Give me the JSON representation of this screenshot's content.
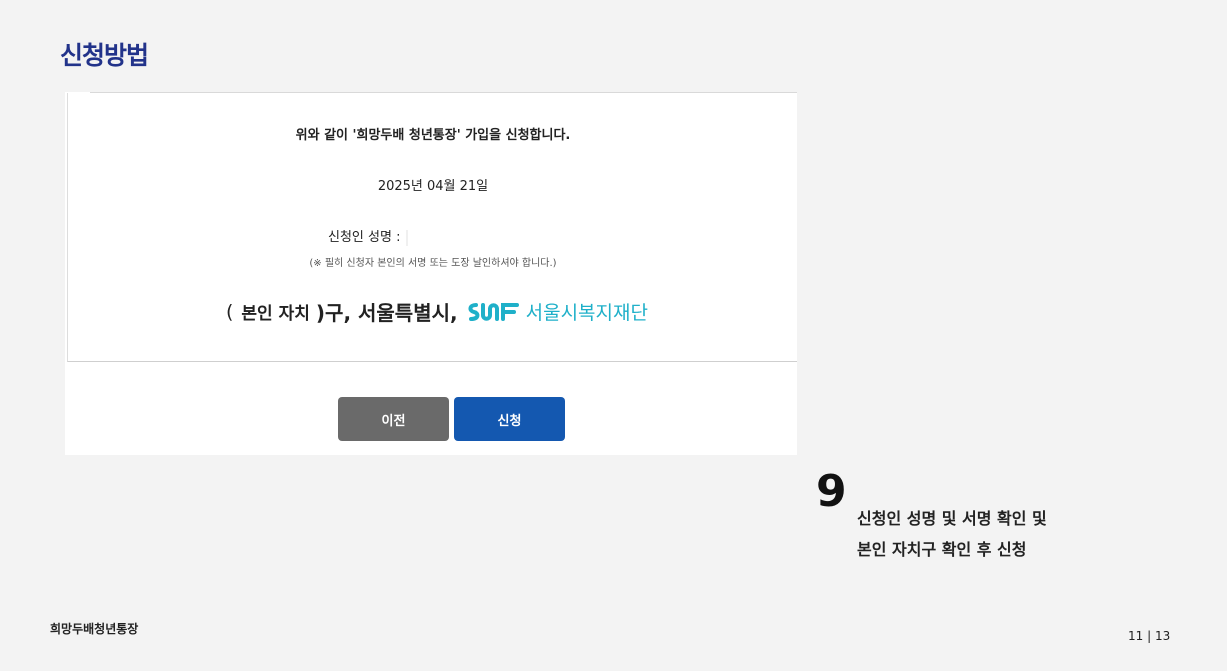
{
  "section_title": "신청방법",
  "form": {
    "statement": "위와 같이 '희망두배 청년통장' 가입을 신청합니다.",
    "date": "2025년 04월 21일",
    "applicant_label": "신청인 성명 :",
    "note": "(※ 필히 신청자 본인의 서명 또는 도장 날인하셔야 합니다.)",
    "region": {
      "open_paren": "(",
      "district": "본인 자치",
      "close_suffix": ")구, 서울특별시,",
      "logo_text": "서울시복지재단",
      "logo_icon": "swf-logo-icon",
      "logo_color": "#1fb0c9"
    }
  },
  "buttons": {
    "prev_label": "이전",
    "submit_label": "신청",
    "prev_color": "#6a6a6a",
    "submit_color": "#1458b0"
  },
  "step": {
    "number": "9",
    "line1": "신청인 성명 및 서명 확인 및",
    "line2": "본인 자치구 확인 후 신청"
  },
  "footer": {
    "left": "희망두배청년통장",
    "page": "11 | 13"
  },
  "colors": {
    "title": "#22338a",
    "background": "#f3f3f3"
  }
}
